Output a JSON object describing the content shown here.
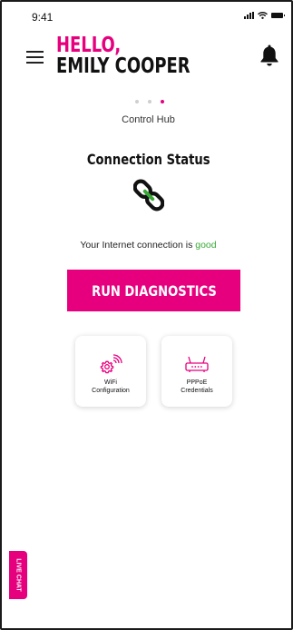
{
  "status_bar": {
    "time": "9:41"
  },
  "header": {
    "greeting": "HELLO,",
    "user_name": "EMILY COOPER"
  },
  "pager": {
    "total": 3,
    "active_index": 2,
    "label": "Control Hub"
  },
  "connection": {
    "title": "Connection Status",
    "status_prefix": "Your Internet connection is ",
    "status_value": "good",
    "status_color": "#39a935"
  },
  "diagnostics": {
    "button_label": "RUN DIAGNOSTICS"
  },
  "cards": {
    "wifi": {
      "line1": "WiFi",
      "line2": "Configuration",
      "icon": "wifi-settings-icon"
    },
    "pppoe": {
      "line1": "PPPoE",
      "line2": "Credentials",
      "icon": "router-icon"
    }
  },
  "live_chat": {
    "label": "LIVE CHAT"
  },
  "colors": {
    "brand": "#e6007e",
    "good": "#39a935"
  }
}
